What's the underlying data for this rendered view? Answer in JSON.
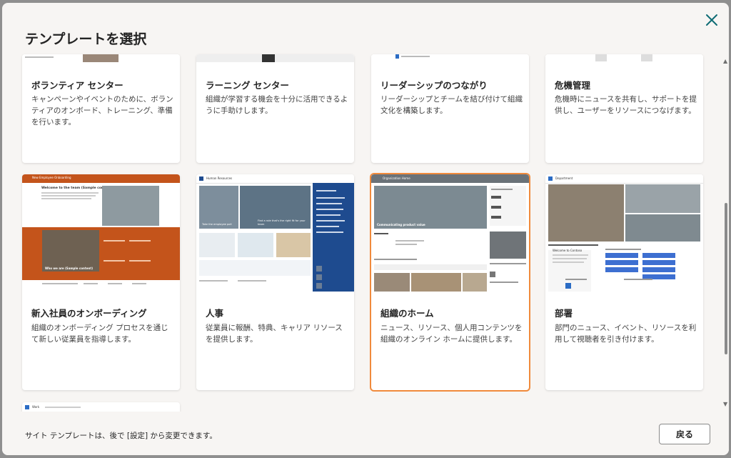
{
  "dialog": {
    "title": "テンプレートを選択",
    "close_label": "✕",
    "footer_text": "サイト テンプレートは、後で [設定] から変更できます。",
    "back_label": "戻る"
  },
  "templates": [
    {
      "title": "ボランティア センター",
      "desc": "キャンペーンやイベントのために、ボランティアのオンボード、トレーニング、準備を行います。"
    },
    {
      "title": "ラーニング センター",
      "desc": "組織が学習する機会を十分に活用できるように手助けします。"
    },
    {
      "title": "リーダーシップのつながり",
      "desc": "リーダーシップとチームを結び付けて組織文化を構築します。"
    },
    {
      "title": "危機管理",
      "desc": "危機時にニュースを共有し、サポートを提供し、ユーザーをリソースにつなげます。"
    },
    {
      "title": "新入社員のオンボーディング",
      "desc": "組織のオンボーディング プロセスを通じて新しい従業員を指導します。",
      "thumb": {
        "header": "New Employee Onboarding",
        "hero": "Welcome to the team (Sample content)",
        "band": "Who we are (Sample content)"
      }
    },
    {
      "title": "人事",
      "desc": "従業員に報酬、特典、キャリア リソースを提供します。",
      "thumb": {
        "header": "Human Resources",
        "cap1": "Take the employee poll",
        "cap2": "Find a role that's the right fit for your team"
      }
    },
    {
      "title": "組織のホーム",
      "desc": "ニュース、リソース、個人用コンテンツを組織のオンライン ホームに提供します。",
      "selected": true,
      "thumb": {
        "header": "Organization Home",
        "caption": "Communicating product value"
      }
    },
    {
      "title": "部署",
      "desc": "部門のニュース、イベント、リソースを利用して視聴者を引き付けます。",
      "thumb": {
        "header": "Department",
        "welcome": "Welcome to Contoso"
      }
    }
  ],
  "partial_card": {
    "header": "Work"
  },
  "colors": {
    "accent": "#f08a3c",
    "onboarding": "#c4541b",
    "hr": "#1e4b8f",
    "close": "#0f6c74"
  }
}
